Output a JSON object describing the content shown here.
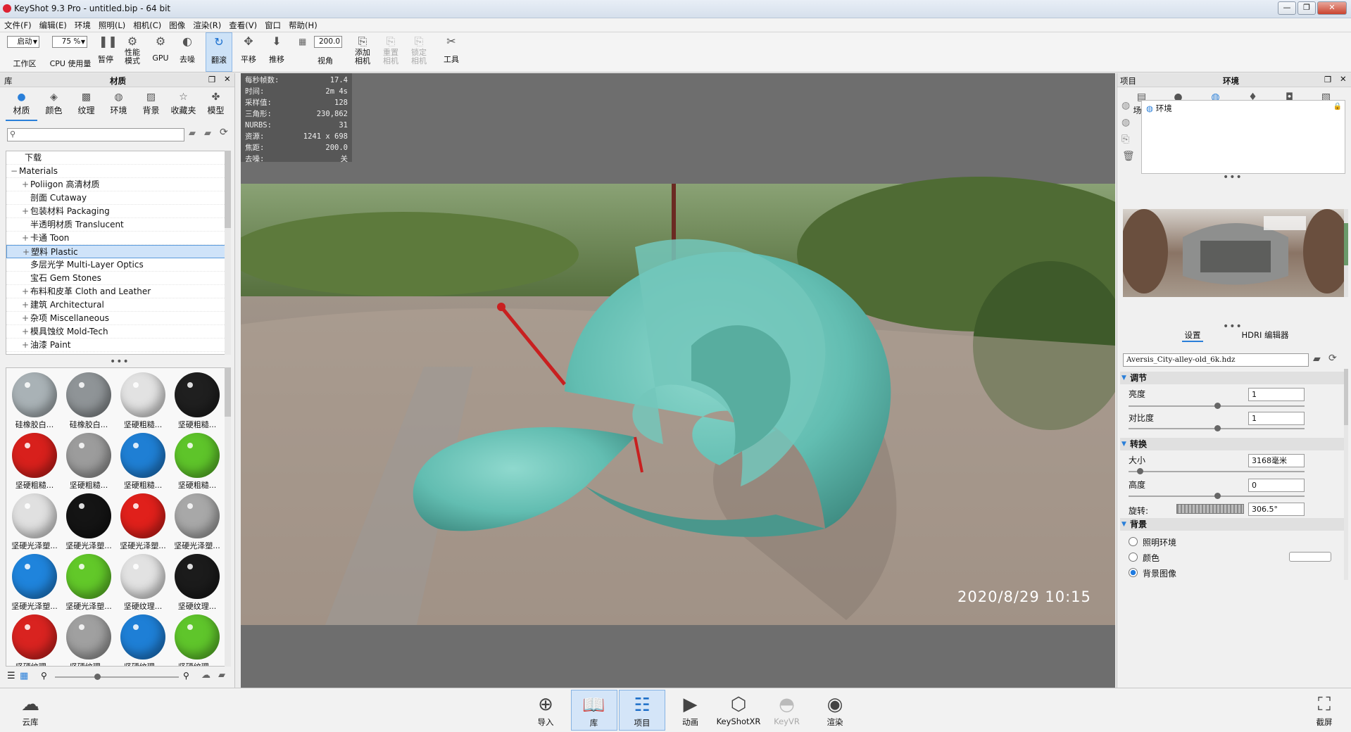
{
  "window": {
    "title": "KeyShot 9.3 Pro  - untitled.bip  - 64 bit"
  },
  "menu": [
    "文件(F)",
    "编辑(E)",
    "环境",
    "照明(L)",
    "相机(C)",
    "图像",
    "渲染(R)",
    "查看(V)",
    "窗口",
    "帮助(H)"
  ],
  "toolbar": {
    "workspace_value": "启动",
    "workspace_label": "工作区",
    "cpu_value": "75 %",
    "cpu_label": "CPU 使用量",
    "pause": "暂停",
    "perf_mode": "性能\n模式",
    "gpu": "GPU",
    "denoise": "去噪",
    "tumble": "翻滚",
    "pan": "平移",
    "dolly": "推移",
    "fov_value": "200.0",
    "fov_label": "视角",
    "add_camera": "添加\n相机",
    "reset_camera": "重置\n相机",
    "lock_camera": "锁定\n相机",
    "tools": "工具"
  },
  "library": {
    "panel_label": "库",
    "title": "材质",
    "tabs": [
      "材质",
      "颜色",
      "纹理",
      "环境",
      "背景",
      "收藏夹",
      "模型"
    ],
    "active_tab": "材质",
    "tree": [
      {
        "label": "下载",
        "indent": 1,
        "expander": ""
      },
      {
        "label": "Materials",
        "indent": 0,
        "expander": "−"
      },
      {
        "label": "Poliigon 高清材质",
        "indent": 2,
        "expander": "+"
      },
      {
        "label": "剖面 Cutaway",
        "indent": 2,
        "expander": ""
      },
      {
        "label": "包装材料 Packaging",
        "indent": 2,
        "expander": "+"
      },
      {
        "label": "半透明材质 Translucent",
        "indent": 2,
        "expander": ""
      },
      {
        "label": "卡通 Toon",
        "indent": 2,
        "expander": "+"
      },
      {
        "label": "塑料 Plastic",
        "indent": 2,
        "expander": "+",
        "selected": true
      },
      {
        "label": "多层光学 Multi-Layer Optics",
        "indent": 2,
        "expander": ""
      },
      {
        "label": "宝石 Gem Stones",
        "indent": 2,
        "expander": ""
      },
      {
        "label": "布料和皮革 Cloth and Leather",
        "indent": 2,
        "expander": "+"
      },
      {
        "label": "建筑 Architectural",
        "indent": 2,
        "expander": "+"
      },
      {
        "label": "杂项 Miscellaneous",
        "indent": 2,
        "expander": "+"
      },
      {
        "label": "模具蚀纹 Mold-Tech",
        "indent": 2,
        "expander": "+"
      },
      {
        "label": "油漆 Paint",
        "indent": 2,
        "expander": "+"
      }
    ],
    "materials": [
      {
        "name": "硅橡胶白...",
        "color": "#a9b2b6"
      },
      {
        "name": "硅橡胶白...",
        "color": "#8f9497"
      },
      {
        "name": "坚硬粗糙...",
        "color": "#e2e2e2"
      },
      {
        "name": "坚硬粗糙...",
        "color": "#1f1f1f"
      },
      {
        "name": "坚硬粗糙...",
        "color": "#d8201c"
      },
      {
        "name": "坚硬粗糙...",
        "color": "#9c9c9c"
      },
      {
        "name": "坚硬粗糙...",
        "color": "#1f7fd4"
      },
      {
        "name": "坚硬粗糙...",
        "color": "#5ec42a"
      },
      {
        "name": "坚硬光泽塑...",
        "color": "#e0e0e0"
      },
      {
        "name": "坚硬光泽塑...",
        "color": "#141414"
      },
      {
        "name": "坚硬光泽塑...",
        "color": "#e0201b"
      },
      {
        "name": "坚硬光泽塑...",
        "color": "#a8a8a8"
      },
      {
        "name": "坚硬光泽塑...",
        "color": "#1f84dc"
      },
      {
        "name": "坚硬光泽塑...",
        "color": "#62c829"
      },
      {
        "name": "坚硬纹理...",
        "color": "#e2e2e2"
      },
      {
        "name": "坚硬纹理...",
        "color": "#1b1b1b"
      },
      {
        "name": "坚硬纹理...",
        "color": "#d92320"
      },
      {
        "name": "坚硬纹理...",
        "color": "#a0a0a0"
      },
      {
        "name": "坚硬纹理...",
        "color": "#1e7fd6"
      },
      {
        "name": "坚硬纹理...",
        "color": "#5fc52b"
      }
    ]
  },
  "viewport": {
    "stats": [
      {
        "k": "每秒帧数:",
        "v": "17.4"
      },
      {
        "k": "时间:",
        "v": "2m 4s"
      },
      {
        "k": "采样值:",
        "v": "128"
      },
      {
        "k": "三角形:",
        "v": "230,862"
      },
      {
        "k": "NURBS:",
        "v": "31"
      },
      {
        "k": "资源:",
        "v": "1241 x 698"
      },
      {
        "k": "焦距:",
        "v": "200.0"
      },
      {
        "k": "去噪:",
        "v": "关"
      }
    ],
    "timestamp": "2020/8/29  10:15",
    "model_color": "#6cc4b8"
  },
  "project": {
    "panel_label": "项目",
    "title": "环境",
    "tabs": [
      "场景",
      "材质",
      "环境",
      "照明",
      "相机",
      "图像"
    ],
    "active_tab": "环境",
    "env_list": [
      "环境"
    ],
    "subtabs": [
      "设置",
      "HDRI 编辑器"
    ],
    "hdri_file": "Aversis_City-alley-old_6k.hdz",
    "adjust": {
      "title": "调节",
      "brightness_label": "亮度",
      "brightness": "1",
      "contrast_label": "对比度",
      "contrast": "1"
    },
    "transform": {
      "title": "转换",
      "size_label": "大小",
      "size": "3168毫米",
      "height_label": "高度",
      "height": "0",
      "rotation_label": "旋转:",
      "rotation": "306.5°"
    },
    "background": {
      "title": "背景",
      "options": [
        "照明环境",
        "颜色",
        "背景图像"
      ],
      "selected": "背景图像"
    }
  },
  "bottom": {
    "cloud": "云库",
    "buttons": [
      {
        "label": "导入",
        "icon": "import-icon"
      },
      {
        "label": "库",
        "icon": "library-icon",
        "active": true
      },
      {
        "label": "项目",
        "icon": "project-icon",
        "active": true
      },
      {
        "label": "动画",
        "icon": "animation-icon"
      },
      {
        "label": "KeyShotXR",
        "icon": "keyshotxr-icon"
      },
      {
        "label": "KeyVR",
        "icon": "keyvr-icon",
        "disabled": true
      },
      {
        "label": "渲染",
        "icon": "render-icon"
      }
    ],
    "screenshot": "截屏"
  }
}
